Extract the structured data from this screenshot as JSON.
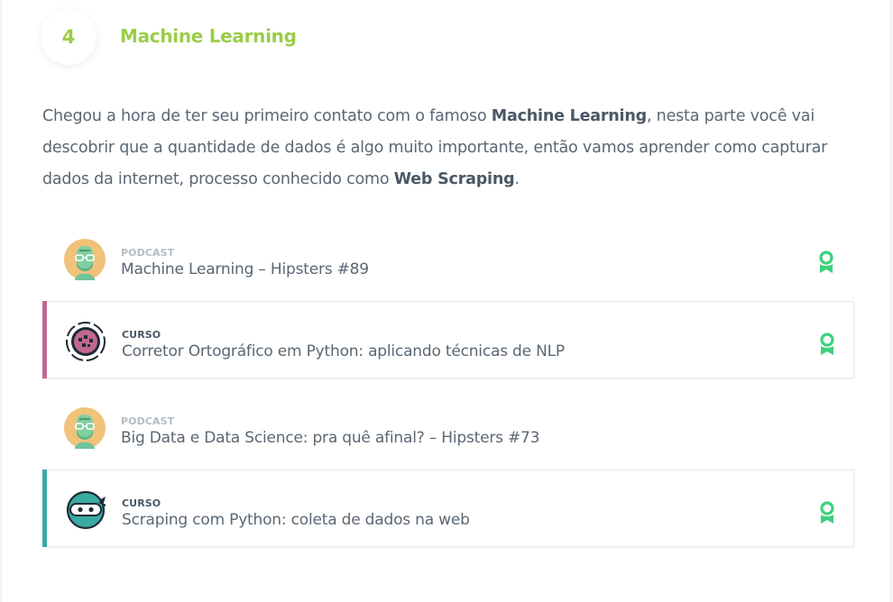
{
  "step": {
    "number": "4",
    "title": "Machine Learning"
  },
  "description": {
    "part1": "Chegou a hora de ter seu primeiro contato com o famoso ",
    "bold1": "Machine Learning",
    "part2": ", nesta parte você vai descobrir que a quantidade de dados é algo muito importante, então vamos aprender como capturar dados da internet, processo conhecido como ",
    "bold2": "Web Scraping",
    "part3": "."
  },
  "items": [
    {
      "kind": "PODCAST",
      "title": "Machine Learning – Hipsters #89",
      "icon": "hipsters-podcast-avatar-icon",
      "badge": "award-ribbon-icon"
    },
    {
      "kind": "CURSO",
      "title": "Corretor Ortográfico em Python: aplicando técnicas de NLP",
      "icon": "nlp-course-icon",
      "accent": "#c06790",
      "badge": "award-ribbon-icon"
    },
    {
      "kind": "PODCAST",
      "title": "Big Data e Data Science: pra quê afinal? – Hipsters #73",
      "icon": "hipsters-podcast-avatar-icon"
    },
    {
      "kind": "CURSO",
      "title": "Scraping com Python: coleta de dados na web",
      "icon": "ninja-scraping-course-icon",
      "accent": "#3aaba3",
      "badge": "award-ribbon-icon"
    }
  ],
  "colors": {
    "step_accent": "#9acd48",
    "badge": "#3dd17e"
  }
}
